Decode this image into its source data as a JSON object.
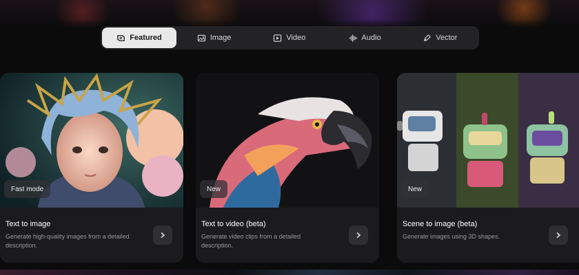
{
  "tabs": [
    {
      "label": "Featured",
      "icon": "featured-icon",
      "active": true
    },
    {
      "label": "Image",
      "icon": "image-icon",
      "active": false
    },
    {
      "label": "Video",
      "icon": "video-icon",
      "active": false
    },
    {
      "label": "Audio",
      "icon": "audio-icon",
      "active": false
    },
    {
      "label": "Vector",
      "icon": "vector-icon",
      "active": false
    }
  ],
  "cards": [
    {
      "badge": "Fast mode",
      "title": "Text to image",
      "description": "Generate high-quality images from a detailed description."
    },
    {
      "badge": "New",
      "title": "Text to video (beta)",
      "description": "Generate video clips from a detailed description."
    },
    {
      "badge": "New",
      "title": "Scene to image (beta)",
      "description": "Generate images using 3D shapes."
    }
  ],
  "colors": {
    "background": "#0b0b0c",
    "card": "#1b1b1d",
    "tabbar": "#232325",
    "active_tab": "#e9e9e9"
  }
}
